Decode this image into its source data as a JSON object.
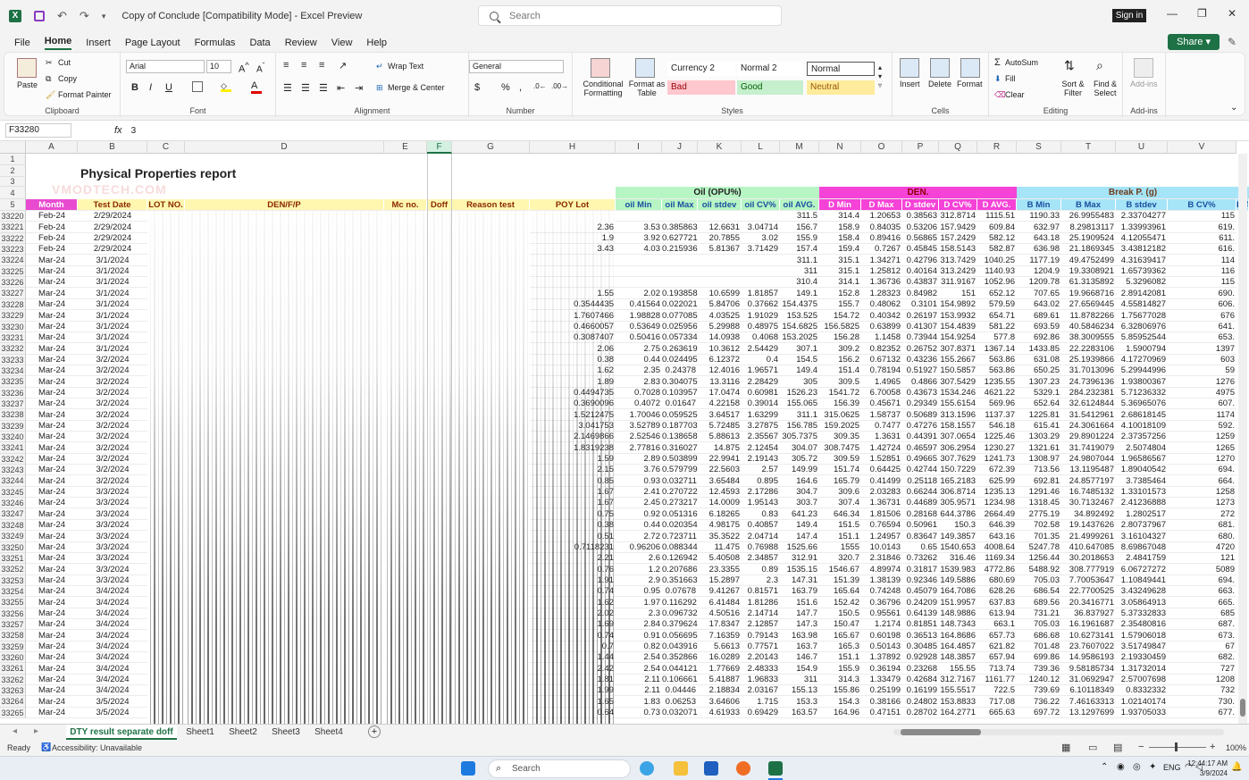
{
  "window": {
    "title": "Copy of Conclude  [Compatibility Mode]  -  Excel Preview",
    "search_placeholder": "Search",
    "signin": "Sign in",
    "minimize": "—",
    "restore": "❐",
    "close": "✕"
  },
  "menu": [
    "File",
    "Home",
    "Insert",
    "Page Layout",
    "Formulas",
    "Data",
    "Review",
    "View",
    "Help"
  ],
  "share_label": "Share",
  "ribbon": {
    "clipboard": {
      "paste": "Paste",
      "cut": "Cut",
      "copy": "Copy",
      "format_painter": "Format Painter",
      "label": "Clipboard"
    },
    "font": {
      "name": "Arial",
      "size": "10",
      "label": "Font"
    },
    "alignment": {
      "wrap": "Wrap Text",
      "merge": "Merge & Center",
      "label": "Alignment"
    },
    "number": {
      "format": "General",
      "label": "Number"
    },
    "styles": {
      "cond": "Conditional Formatting",
      "table": "Format as Table",
      "currency2": "Currency 2",
      "normal2": "Normal 2",
      "normal": "Normal",
      "bad": "Bad",
      "good": "Good",
      "neutral": "Neutral",
      "label": "Styles"
    },
    "cells": {
      "insert": "Insert",
      "delete": "Delete",
      "format": "Format",
      "label": "Cells"
    },
    "editing": {
      "autosum": "AutoSum",
      "fill": "Fill",
      "clear": "Clear",
      "sort": "Sort & Filter",
      "find": "Find & Select",
      "label": "Editing"
    },
    "addins": {
      "addins": "Add-ins",
      "label": "Add-ins"
    }
  },
  "formula": {
    "namebox": "F33280",
    "fx": "fx",
    "value": "3"
  },
  "watermark": "VMODTECH.COM",
  "columns": [
    "A",
    "B",
    "C",
    "D",
    "E",
    "F",
    "G",
    "H",
    "I",
    "J",
    "K",
    "L",
    "M",
    "N",
    "O",
    "P",
    "Q",
    "R",
    "S",
    "T",
    "U",
    "V"
  ],
  "top_rows": [
    "1",
    "2",
    "3",
    "4",
    "5"
  ],
  "report_title": "Physical Properties report",
  "group_headers": {
    "oil": "Oil  (OPU%)",
    "den": "DEN.",
    "break": "Break P. (g)"
  },
  "headers": [
    "Month",
    "Test Date",
    "LOT NO.",
    "DEN/F/P",
    "Mc no.",
    "Doff",
    "Reason test",
    "POY Lot",
    "oil Min",
    "oil Max",
    "oil stdev",
    "oil CV%",
    "oil AVG.",
    "D Min",
    "D Max",
    "D stdev",
    "D CV%",
    "D AVG.",
    "B Min",
    "B Max",
    "B stdev",
    "B CV%",
    "B A"
  ],
  "rows": [
    [
      "33220",
      "Feb-24",
      "2/29/2024",
      "",
      "",
      "",
      "",
      "311.5",
      "314.4",
      "1.20653",
      "0.38563",
      "312.8714",
      "1115.51",
      "1190.33",
      "26.9955483",
      "2.33704277",
      "115"
    ],
    [
      "33221",
      "Feb-24",
      "2/29/2024",
      "2.36",
      "3.53",
      "0.385863",
      "12.6631",
      "3.04714",
      "156.7",
      "158.9",
      "0.84035",
      "0.53206",
      "157.9429",
      "609.84",
      "632.97",
      "8.29813117",
      "1.33993961",
      "619."
    ],
    [
      "33222",
      "Feb-24",
      "2/29/2024",
      "1.9",
      "3.92",
      "0.627721",
      "20.7855",
      "3.02",
      "155.9",
      "158.4",
      "0.89416",
      "0.56865",
      "157.2429",
      "582.12",
      "643.18",
      "25.1909524",
      "4.12055471",
      "611."
    ],
    [
      "33223",
      "Feb-24",
      "2/29/2024",
      "3.43",
      "4.03",
      "0.215936",
      "5.81367",
      "3.71429",
      "157.4",
      "159.4",
      "0.7267",
      "0.45845",
      "158.5143",
      "582.87",
      "636.98",
      "21.1869345",
      "3.43812182",
      "616."
    ],
    [
      "33224",
      "Mar-24",
      "3/1/2024",
      "",
      "",
      "",
      "",
      "",
      "311.1",
      "315.1",
      "1.34271",
      "0.42796",
      "313.7429",
      "1040.25",
      "1177.19",
      "49.4752499",
      "4.31639417",
      "114"
    ],
    [
      "33225",
      "Mar-24",
      "3/1/2024",
      "",
      "",
      "",
      "",
      "",
      "311",
      "315.1",
      "1.25812",
      "0.40164",
      "313.2429",
      "1140.93",
      "1204.9",
      "19.3308921",
      "1.65739362",
      "116"
    ],
    [
      "33226",
      "Mar-24",
      "3/1/2024",
      "",
      "",
      "",
      "",
      "",
      "310.4",
      "314.1",
      "1.36736",
      "0.43837",
      "311.9167",
      "1052.96",
      "1209.78",
      "61.3135892",
      "5.3296082",
      "115"
    ],
    [
      "33227",
      "Mar-24",
      "3/1/2024",
      "1.55",
      "2.02",
      "0.193858",
      "10.6599",
      "1.81857",
      "149.1",
      "152.8",
      "1.28323",
      "0.84982",
      "151",
      "652.12",
      "707.65",
      "19.9668716",
      "2.89142081",
      "690."
    ],
    [
      "33228",
      "Mar-24",
      "3/1/2024",
      "0.3544435",
      "0.41564",
      "0.022021",
      "5.84706",
      "0.37662",
      "154.4375",
      "155.7",
      "0.48062",
      "0.3101",
      "154.9892",
      "579.59",
      "643.02",
      "27.6569445",
      "4.55814827",
      "606."
    ],
    [
      "33229",
      "Mar-24",
      "3/1/2024",
      "1.7607466",
      "1.98828",
      "0.077085",
      "4.03525",
      "1.91029",
      "153.525",
      "154.72",
      "0.40342",
      "0.26197",
      "153.9932",
      "654.71",
      "689.61",
      "11.8782266",
      "1.75677028",
      "676"
    ],
    [
      "33230",
      "Mar-24",
      "3/1/2024",
      "0.4660057",
      "0.53649",
      "0.025956",
      "5.29988",
      "0.48975",
      "154.6825",
      "156.5825",
      "0.63899",
      "0.41307",
      "154.4839",
      "581.22",
      "693.59",
      "40.5846234",
      "6.32806976",
      "641."
    ],
    [
      "33231",
      "Mar-24",
      "3/1/2024",
      "0.3087407",
      "0.50416",
      "0.057334",
      "14.0938",
      "0.4068",
      "153.2025",
      "156.28",
      "1.1458",
      "0.73944",
      "154.9254",
      "577.8",
      "692.86",
      "38.3009555",
      "5.85952544",
      "653."
    ],
    [
      "33232",
      "Mar-24",
      "3/1/2024",
      "2.06",
      "2.75",
      "0.263619",
      "10.3612",
      "2.54429",
      "307.1",
      "309.2",
      "0.82352",
      "0.26752",
      "307.8371",
      "1367.14",
      "1433.85",
      "22.2283106",
      "1.5900794",
      "1397"
    ],
    [
      "33233",
      "Mar-24",
      "3/2/2024",
      "0.38",
      "0.44",
      "0.024495",
      "6.12372",
      "0.4",
      "154.5",
      "156.2",
      "0.67132",
      "0.43236",
      "155.2667",
      "563.86",
      "631.08",
      "25.1939866",
      "4.17270969",
      "603"
    ],
    [
      "33234",
      "Mar-24",
      "3/2/2024",
      "1.62",
      "2.35",
      "0.24378",
      "12.4016",
      "1.96571",
      "149.4",
      "151.4",
      "0.78194",
      "0.51927",
      "150.5857",
      "563.86",
      "650.25",
      "31.7013096",
      "5.29944996",
      "59"
    ],
    [
      "33235",
      "Mar-24",
      "3/2/2024",
      "1.89",
      "2.83",
      "0.304075",
      "13.3116",
      "2.28429",
      "305",
      "309.5",
      "1.4965",
      "0.4866",
      "307.5429",
      "1235.55",
      "1307.23",
      "24.7396136",
      "1.93800367",
      "1276"
    ],
    [
      "33236",
      "Mar-24",
      "3/2/2024",
      "0.4494735",
      "0.7028",
      "0.103957",
      "17.0474",
      "0.60981",
      "1526.23",
      "1541.72",
      "6.70058",
      "0.43673",
      "1534.246",
      "4621.22",
      "5329.1",
      "284.232381",
      "5.71236332",
      "4975"
    ],
    [
      "33237",
      "Mar-24",
      "3/2/2024",
      "0.3690096",
      "0.4072",
      "0.01647",
      "4.22158",
      "0.39014",
      "155.065",
      "156.39",
      "0.45671",
      "0.29349",
      "155.6154",
      "569.96",
      "652.64",
      "32.6124844",
      "5.36965076",
      "607."
    ],
    [
      "33238",
      "Mar-24",
      "3/2/2024",
      "1.5212475",
      "1.70046",
      "0.059525",
      "3.64517",
      "1.63299",
      "311.1",
      "315.0625",
      "1.58737",
      "0.50689",
      "313.1596",
      "1137.37",
      "1225.81",
      "31.5412961",
      "2.68618145",
      "1174"
    ],
    [
      "33239",
      "Mar-24",
      "3/2/2024",
      "3.041753",
      "3.52789",
      "0.187703",
      "5.72485",
      "3.27875",
      "156.785",
      "159.2025",
      "0.7477",
      "0.47276",
      "158.1557",
      "546.18",
      "615.41",
      "24.3061664",
      "4.10018109",
      "592."
    ],
    [
      "33240",
      "Mar-24",
      "3/2/2024",
      "2.1469866",
      "2.52546",
      "0.138658",
      "5.88613",
      "2.35567",
      "305.7375",
      "309.35",
      "1.3631",
      "0.44391",
      "307.0654",
      "1225.46",
      "1303.29",
      "29.8901224",
      "2.37357256",
      "1259"
    ],
    [
      "33241",
      "Mar-24",
      "3/2/2024",
      "1.8319238",
      "2.77816",
      "0.316027",
      "14.875",
      "2.12454",
      "304.07",
      "308.7475",
      "1.42724",
      "0.46597",
      "306.2954",
      "1230.27",
      "1321.61",
      "31.7419079",
      "2.5074804",
      "1265"
    ],
    [
      "33242",
      "Mar-24",
      "3/2/2024",
      "1.59",
      "2.89",
      "0.503899",
      "22.9941",
      "2.19143",
      "305.72",
      "309.59",
      "1.52851",
      "0.49665",
      "307.7629",
      "1241.73",
      "1308.97",
      "24.9807044",
      "1.96586567",
      "1270"
    ],
    [
      "33243",
      "Mar-24",
      "3/2/2024",
      "2.15",
      "3.76",
      "0.579799",
      "22.5603",
      "2.57",
      "149.99",
      "151.74",
      "0.64425",
      "0.42744",
      "150.7229",
      "672.39",
      "713.56",
      "13.1195487",
      "1.89040542",
      "694."
    ],
    [
      "33244",
      "Mar-24",
      "3/2/2024",
      "0.85",
      "0.93",
      "0.032711",
      "3.65484",
      "0.895",
      "164.6",
      "165.79",
      "0.41499",
      "0.25118",
      "165.2183",
      "625.99",
      "692.81",
      "24.8577197",
      "3.7385464",
      "664."
    ],
    [
      "33245",
      "Mar-24",
      "3/3/2024",
      "1.67",
      "2.41",
      "0.270722",
      "12.4593",
      "2.17286",
      "304.7",
      "309.6",
      "2.03283",
      "0.66244",
      "306.8714",
      "1235.13",
      "1291.46",
      "16.7485132",
      "1.33101573",
      "1258"
    ],
    [
      "33246",
      "Mar-24",
      "3/3/2024",
      "1.67",
      "2.45",
      "0.273217",
      "14.0009",
      "1.95143",
      "303.7",
      "307.4",
      "1.36731",
      "0.44689",
      "305.9571",
      "1234.98",
      "1318.45",
      "30.7132467",
      "2.41236888",
      "1273"
    ],
    [
      "33247",
      "Mar-24",
      "3/3/2024",
      "0.75",
      "0.92",
      "0.051316",
      "6.18265",
      "0.83",
      "641.23",
      "646.34",
      "1.81506",
      "0.28168",
      "644.3786",
      "2664.49",
      "2775.19",
      "34.892492",
      "1.2802517",
      "272"
    ],
    [
      "33248",
      "Mar-24",
      "3/3/2024",
      "0.38",
      "0.44",
      "0.020354",
      "4.98175",
      "0.40857",
      "149.4",
      "151.5",
      "0.76594",
      "0.50961",
      "150.3",
      "646.39",
      "702.58",
      "19.1437626",
      "2.80737967",
      "681."
    ],
    [
      "33249",
      "Mar-24",
      "3/3/2024",
      "0.51",
      "2.72",
      "0.723711",
      "35.3522",
      "2.04714",
      "147.4",
      "151.1",
      "1.24957",
      "0.83647",
      "149.3857",
      "643.16",
      "701.35",
      "21.4999261",
      "3.16104327",
      "680."
    ],
    [
      "33250",
      "Mar-24",
      "3/3/2024",
      "0.7118231",
      "0.96206",
      "0.088344",
      "11.475",
      "0.76988",
      "1525.66",
      "1555",
      "10.0143",
      "0.65",
      "1540.653",
      "4008.64",
      "5247.78",
      "410.647085",
      "8.69867048",
      "4720"
    ],
    [
      "33251",
      "Mar-24",
      "3/3/2024",
      "2.21",
      "2.6",
      "0.126942",
      "5.40508",
      "2.34857",
      "312.91",
      "320.7",
      "2.31846",
      "0.73262",
      "316.46",
      "1169.34",
      "1256.44",
      "30.2018653",
      "2.4841759",
      "121"
    ],
    [
      "33252",
      "Mar-24",
      "3/3/2024",
      "0.76",
      "1.2",
      "0.207686",
      "23.3355",
      "0.89",
      "1535.15",
      "1546.67",
      "4.89974",
      "0.31817",
      "1539.983",
      "4772.86",
      "5488.92",
      "308.777919",
      "6.06727272",
      "5089"
    ],
    [
      "33253",
      "Mar-24",
      "3/3/2024",
      "1.91",
      "2.9",
      "0.351663",
      "15.2897",
      "2.3",
      "147.31",
      "151.39",
      "1.38139",
      "0.92346",
      "149.5886",
      "680.69",
      "705.03",
      "7.70053647",
      "1.10849441",
      "694."
    ],
    [
      "33254",
      "Mar-24",
      "3/4/2024",
      "0.74",
      "0.95",
      "0.07678",
      "9.41267",
      "0.81571",
      "163.79",
      "165.64",
      "0.74248",
      "0.45079",
      "164.7086",
      "628.26",
      "686.54",
      "22.7700525",
      "3.43249628",
      "663."
    ],
    [
      "33255",
      "Mar-24",
      "3/4/2024",
      "1.62",
      "1.97",
      "0.116292",
      "6.41484",
      "1.81286",
      "151.6",
      "152.42",
      "0.36796",
      "0.24209",
      "151.9957",
      "637.83",
      "689.56",
      "20.3416771",
      "3.05864913",
      "665."
    ],
    [
      "33256",
      "Mar-24",
      "3/4/2024",
      "2.02",
      "2.3",
      "0.096732",
      "4.50516",
      "2.14714",
      "147.7",
      "150.5",
      "0.95561",
      "0.64139",
      "148.9886",
      "613.94",
      "731.21",
      "36.837927",
      "5.37332833",
      "685"
    ],
    [
      "33257",
      "Mar-24",
      "3/4/2024",
      "1.69",
      "2.84",
      "0.379624",
      "17.8347",
      "2.12857",
      "147.3",
      "150.47",
      "1.2174",
      "0.81851",
      "148.7343",
      "663.1",
      "705.03",
      "16.1961687",
      "2.35480816",
      "687."
    ],
    [
      "33258",
      "Mar-24",
      "3/4/2024",
      "0.74",
      "0.91",
      "0.056695",
      "7.16359",
      "0.79143",
      "163.98",
      "165.67",
      "0.60198",
      "0.36513",
      "164.8686",
      "657.73",
      "686.68",
      "10.6273141",
      "1.57906018",
      "673."
    ],
    [
      "33259",
      "Mar-24",
      "3/4/2024",
      "0.7",
      "0.82",
      "0.043916",
      "5.6613",
      "0.77571",
      "163.7",
      "165.3",
      "0.50143",
      "0.30485",
      "164.4857",
      "621.82",
      "701.48",
      "23.7607022",
      "3.51749847",
      "67"
    ],
    [
      "33260",
      "Mar-24",
      "3/4/2024",
      "1.44",
      "2.54",
      "0.352866",
      "16.0289",
      "2.20143",
      "146.7",
      "151.1",
      "1.37892",
      "0.92928",
      "148.3857",
      "657.94",
      "699.86",
      "14.9586193",
      "2.19330459",
      "682."
    ],
    [
      "33261",
      "Mar-24",
      "3/4/2024",
      "2.42",
      "2.54",
      "0.044121",
      "1.77669",
      "2.48333",
      "154.9",
      "155.9",
      "0.36194",
      "0.23268",
      "155.55",
      "713.74",
      "739.36",
      "9.58185734",
      "1.31732014",
      "727"
    ],
    [
      "33262",
      "Mar-24",
      "3/4/2024",
      "1.81",
      "2.11",
      "0.106661",
      "5.41887",
      "1.96833",
      "311",
      "314.3",
      "1.33479",
      "0.42684",
      "312.7167",
      "1161.77",
      "1240.12",
      "31.0692947",
      "2.57007698",
      "1208"
    ],
    [
      "33263",
      "Mar-24",
      "3/4/2024",
      "1.99",
      "2.11",
      "0.04446",
      "2.18834",
      "2.03167",
      "155.13",
      "155.86",
      "0.25199",
      "0.16199",
      "155.5517",
      "722.5",
      "739.69",
      "6.10118349",
      "0.8332332",
      "732"
    ],
    [
      "33264",
      "Mar-24",
      "3/5/2024",
      "1.65",
      "1.83",
      "0.06253",
      "3.64606",
      "1.715",
      "153.3",
      "154.3",
      "0.38166",
      "0.24802",
      "153.8833",
      "717.08",
      "736.22",
      "7.46163313",
      "1.02140174",
      "730."
    ],
    [
      "33265",
      "Mar-24",
      "3/5/2024",
      "0.64",
      "0.73",
      "0.032071",
      "4.61933",
      "0.69429",
      "163.57",
      "164.96",
      "0.47151",
      "0.28702",
      "164.2771",
      "665.63",
      "697.72",
      "13.1297699",
      "1.93705033",
      "677."
    ]
  ],
  "sheet_tabs": [
    "DTY result separate doff",
    "Sheet1",
    "Sheet2",
    "Sheet3",
    "Sheet4"
  ],
  "status": {
    "ready": "Ready",
    "accessibility": "Accessibility: Unavailable",
    "zoom": "100%"
  },
  "taskbar": {
    "search": "Search",
    "lang": "ENG",
    "time": "12:44:17 AM",
    "date": "3/9/2024"
  },
  "colors": {
    "accent": "#1e7145",
    "month_header": "#e84bd0",
    "yellow_header": "#fff7b0",
    "oil_header": "#b7f5c4",
    "den_header": "#f542d7",
    "break_header": "#a6e4f7",
    "title_bar": "#f3f3f3"
  }
}
